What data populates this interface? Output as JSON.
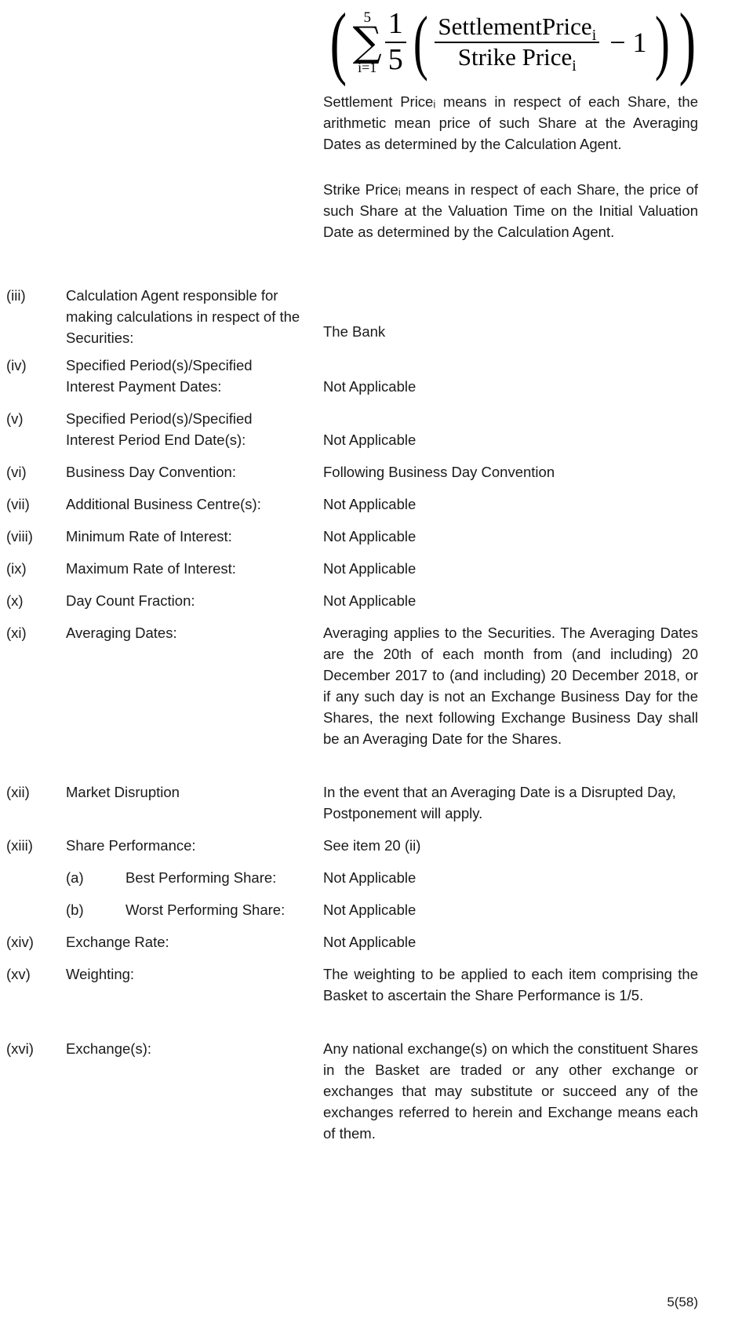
{
  "document": {
    "formula": {
      "sigma_upper": "5",
      "sigma_lower": "i=1",
      "sigma_glyph": "∑",
      "coefficient_numerator": "1",
      "coefficient_denominator": "5",
      "fraction_numerator": "SettlementPrice",
      "fraction_numerator_sub": "i",
      "fraction_denominator": "Strike Price",
      "fraction_denominator_sub": "i",
      "minus_one": "− 1"
    },
    "definitions": [
      {
        "id": "settlement-price-definition",
        "text": "Settlement Priceᵢ means in respect of each Share, the arithmetic mean price of such Share at the Averaging Dates as determined by the Calculation Agent."
      },
      {
        "id": "strike-price-definition",
        "text": "Strike Priceᵢ means in respect of each Share, the price of such Share at the Valuation Time on the Initial Valuation Date as determined by the Calculation Agent."
      }
    ],
    "items": [
      {
        "numeral": "(iii)",
        "label": "Calculation Agent responsible for making calculations in respect of the Securities:",
        "value": "The Bank"
      },
      {
        "numeral": "(iv)",
        "label": "Specified Period(s)/Specified Interest Payment Dates:",
        "value": "Not Applicable"
      },
      {
        "numeral": "(v)",
        "label": "Specified Period(s)/Specified Interest Period End Date(s):",
        "value": "Not Applicable"
      },
      {
        "numeral": "(vi)",
        "label": "Business Day Convention:",
        "value": "Following Business Day Convention"
      },
      {
        "numeral": "(vii)",
        "label": "Additional Business Centre(s):",
        "value": "Not Applicable"
      },
      {
        "numeral": "(viii)",
        "label": "Minimum Rate of Interest:",
        "value": "Not Applicable"
      },
      {
        "numeral": "(ix)",
        "label": "Maximum Rate of Interest:",
        "value": "Not Applicable"
      },
      {
        "numeral": "(x)",
        "label": "Day Count Fraction:",
        "value": "Not Applicable"
      },
      {
        "numeral": "(xi)",
        "label": "Averaging Dates:",
        "value": "Averaging applies to the Securities. The Averaging Dates are the 20th of each month from (and including) 20 December 2017 to (and including) 20 December 2018, or if any such day is not an Exchange Business Day for the Shares, the next following Exchange Business Day shall be an Averaging Date for the Shares."
      },
      {
        "numeral": "(xii)",
        "label": "Market Disruption",
        "value": "In the event that an Averaging Date is a Disrupted Day, Postponement will apply."
      },
      {
        "numeral": "(xiii)",
        "label": "Share Performance:",
        "value": "See item 20 (ii)"
      },
      {
        "numeral": "(a)",
        "label": "Best Performing Share:",
        "value": "Not Applicable"
      },
      {
        "numeral": "(b)",
        "label": "Worst Performing Share:",
        "value": "Not Applicable"
      },
      {
        "numeral": "(xiv)",
        "label": "Exchange Rate:",
        "value": "Not Applicable"
      },
      {
        "numeral": "(xv)",
        "label": "Weighting:",
        "value": "The weighting to be applied to each item comprising the Basket to ascertain the Share Performance is 1/5."
      },
      {
        "numeral": "(xvi)",
        "label": "Exchange(s):",
        "value": "Any national exchange(s) on which the constituent Shares in the Basket are traded or any other exchange or exchanges that may substitute or succeed any of the exchanges referred to herein and Exchange means each of them."
      }
    ],
    "footer": {
      "page_number": "5(58)"
    }
  }
}
